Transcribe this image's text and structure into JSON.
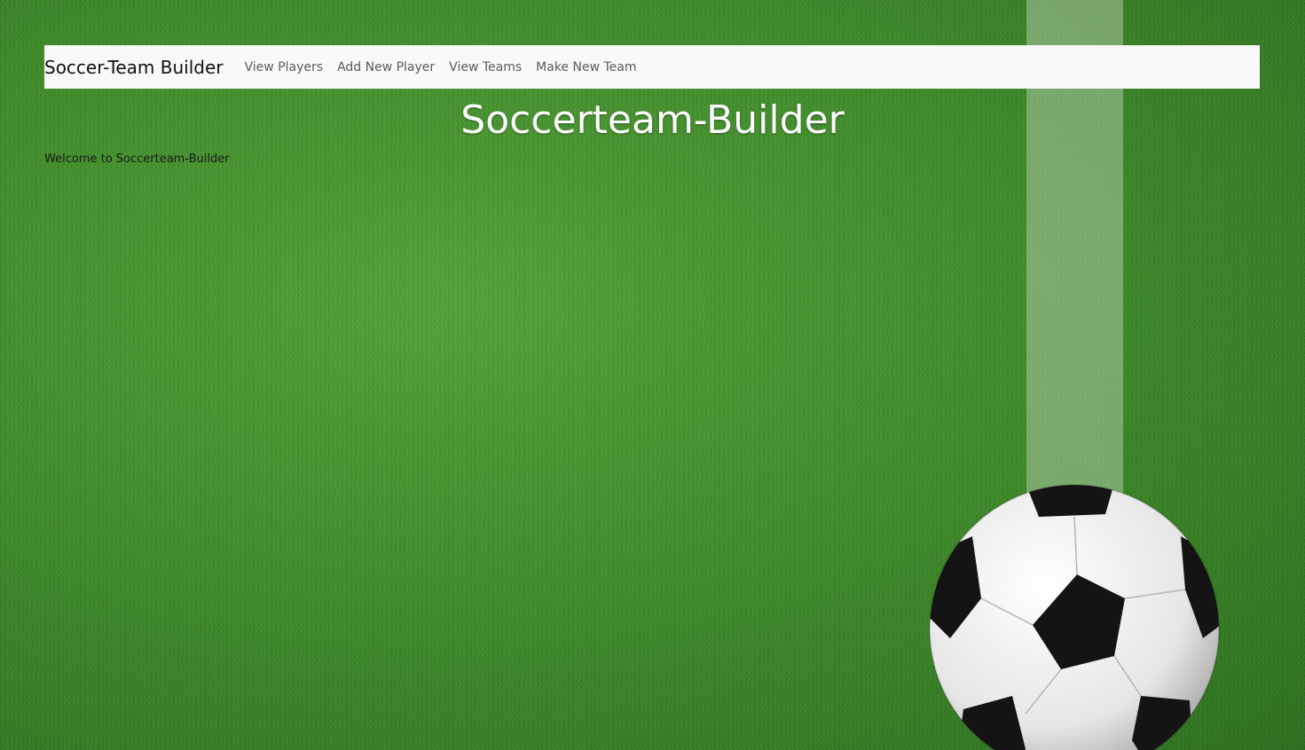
{
  "navbar": {
    "brand": "Soccer-Team Builder",
    "links": [
      {
        "label": "View Players"
      },
      {
        "label": "Add New Player"
      },
      {
        "label": "View Teams"
      },
      {
        "label": "Make New Team"
      }
    ]
  },
  "main": {
    "title": "Soccerteam-Builder",
    "welcome": "Welcome to Soccerteam-Builder"
  },
  "background": {
    "image": "soccer-field-grass",
    "decoration": "soccer-ball"
  },
  "colors": {
    "navbar_bg": "#f8f9fa",
    "grass": "#3f8a2a",
    "title_text": "#ffffff"
  }
}
